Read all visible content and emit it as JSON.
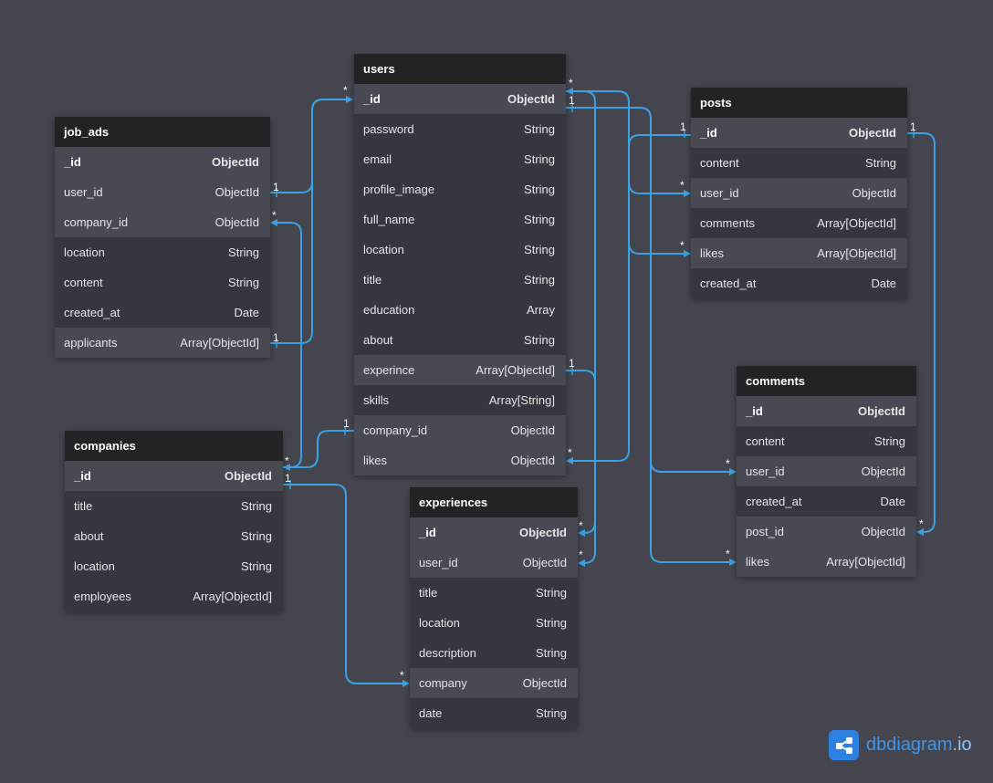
{
  "tables": {
    "job_ads": {
      "title": "job_ads",
      "fields": [
        {
          "name": "_id",
          "type": "ObjectId",
          "pk": true
        },
        {
          "name": "user_id",
          "type": "ObjectId"
        },
        {
          "name": "company_id",
          "type": "ObjectId"
        },
        {
          "name": "location",
          "type": "String"
        },
        {
          "name": "content",
          "type": "String"
        },
        {
          "name": "created_at",
          "type": "Date"
        },
        {
          "name": "applicants",
          "type": "Array[ObjectId]"
        }
      ]
    },
    "users": {
      "title": "users",
      "fields": [
        {
          "name": "_id",
          "type": "ObjectId",
          "pk": true
        },
        {
          "name": "password",
          "type": "String"
        },
        {
          "name": "email",
          "type": "String"
        },
        {
          "name": "profile_image",
          "type": "String"
        },
        {
          "name": "full_name",
          "type": "String"
        },
        {
          "name": "location",
          "type": "String"
        },
        {
          "name": "title",
          "type": "String"
        },
        {
          "name": "education",
          "type": "Array"
        },
        {
          "name": "about",
          "type": "String"
        },
        {
          "name": "experince",
          "type": "Array[ObjectId]"
        },
        {
          "name": "skills",
          "type": "Array[String]"
        },
        {
          "name": "company_id",
          "type": "ObjectId"
        },
        {
          "name": "likes",
          "type": "ObjectId"
        }
      ]
    },
    "posts": {
      "title": "posts",
      "fields": [
        {
          "name": "_id",
          "type": "ObjectId",
          "pk": true
        },
        {
          "name": "content",
          "type": "String"
        },
        {
          "name": "user_id",
          "type": "ObjectId"
        },
        {
          "name": "comments",
          "type": "Array[ObjectId]"
        },
        {
          "name": "likes",
          "type": "Array[ObjectId]"
        },
        {
          "name": "created_at",
          "type": "Date"
        }
      ]
    },
    "comments": {
      "title": "comments",
      "fields": [
        {
          "name": "_id",
          "type": "ObjectId",
          "pk": true
        },
        {
          "name": "content",
          "type": "String"
        },
        {
          "name": "user_id",
          "type": "ObjectId"
        },
        {
          "name": "created_at",
          "type": "Date"
        },
        {
          "name": "post_id",
          "type": "ObjectId"
        },
        {
          "name": "likes",
          "type": "Array[ObjectId]"
        }
      ]
    },
    "companies": {
      "title": "companies",
      "fields": [
        {
          "name": "_id",
          "type": "ObjectId",
          "pk": true
        },
        {
          "name": "title",
          "type": "String"
        },
        {
          "name": "about",
          "type": "String"
        },
        {
          "name": "location",
          "type": "String"
        },
        {
          "name": "employees",
          "type": "Array[ObjectId]"
        }
      ]
    },
    "experiences": {
      "title": "experiences",
      "fields": [
        {
          "name": "_id",
          "type": "ObjectId",
          "pk": true
        },
        {
          "name": "user_id",
          "type": "ObjectId"
        },
        {
          "name": "title",
          "type": "String"
        },
        {
          "name": "location",
          "type": "String"
        },
        {
          "name": "description",
          "type": "String"
        },
        {
          "name": "company",
          "type": "ObjectId"
        },
        {
          "name": "date",
          "type": "String"
        }
      ]
    }
  },
  "relationships": [
    {
      "from": "job_ads.user_id",
      "to": "users._id",
      "from_card": "1",
      "to_card": "*"
    },
    {
      "from": "job_ads.applicants",
      "to": "users._id",
      "from_card": "1",
      "to_card": "*"
    },
    {
      "from": "companies._id",
      "to": "job_ads.company_id",
      "from_card": "*",
      "to_card": "*"
    },
    {
      "from": "companies._id",
      "to": "users.company_id",
      "from_card": "*",
      "to_card": "1"
    },
    {
      "from": "companies._id",
      "to": "experiences.company",
      "from_card": "1",
      "to_card": "*"
    },
    {
      "from": "users._id",
      "to": "users.likes",
      "from_card": "*",
      "to_card": "*"
    },
    {
      "from": "users._id",
      "to": "posts.user_id",
      "from_card": "1",
      "to_card": "*"
    },
    {
      "from": "users._id",
      "to": "comments.user_id",
      "from_card": "1",
      "to_card": "*"
    },
    {
      "from": "users._id",
      "to": "comments.likes",
      "from_card": "1",
      "to_card": "*"
    },
    {
      "from": "users._id",
      "to": "experiences.user_id",
      "from_card": "*",
      "to_card": "*"
    },
    {
      "from": "users.experince",
      "to": "experiences._id",
      "from_card": "1",
      "to_card": "*"
    },
    {
      "from": "posts._id",
      "to": "posts.likes",
      "from_card": "1",
      "to_card": "*"
    },
    {
      "from": "posts._id",
      "to": "comments.post_id",
      "from_card": "1",
      "to_card": "*"
    }
  ],
  "brand": {
    "name": "dbdiagram",
    "tld": ".io",
    "logo_icon": "share-nodes-icon"
  },
  "colors": {
    "background": "#44454f",
    "header": "#232323",
    "row": "#35363f",
    "row_highlight": "#484952",
    "connector": "#3aa2e2",
    "brand": "#3f95ea"
  }
}
